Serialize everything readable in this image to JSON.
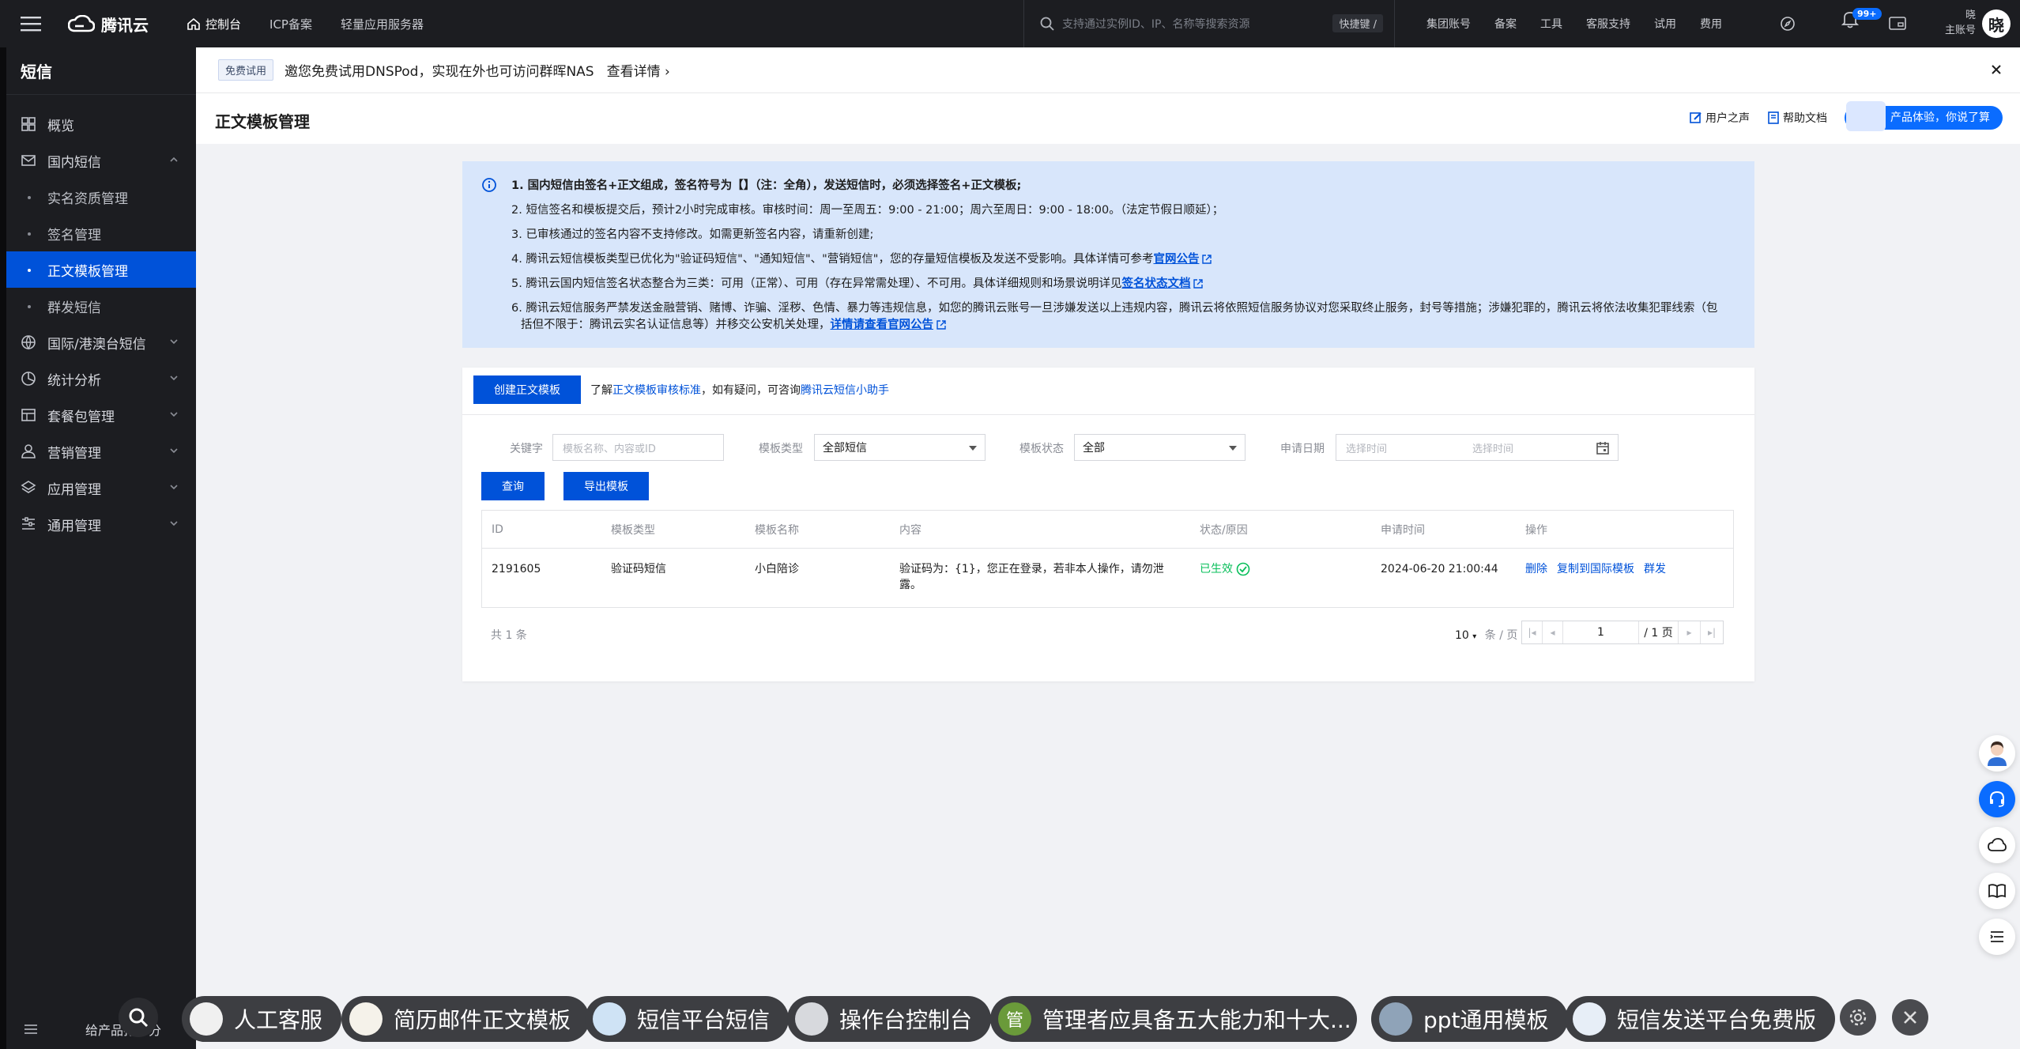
{
  "topbar": {
    "brand": "腾讯云",
    "nav": [
      "控制台",
      "ICP备案",
      "轻量应用服务器"
    ],
    "search_placeholder": "支持通过实例ID、IP、名称等搜索资源",
    "shortcut": "快捷键 /",
    "right_links": [
      "集团账号",
      "备案",
      "工具",
      "客服支持",
      "试用",
      "费用"
    ],
    "notif_count": "99+",
    "user_name": "晓",
    "user_role": "主账号",
    "avatar_char": "晓"
  },
  "sidebar": {
    "title": "短信",
    "items": [
      {
        "label": "概览",
        "icon": "dashboard-icon"
      },
      {
        "label": "国内短信",
        "icon": "mail-icon",
        "expanded": true
      },
      {
        "label": "实名资质管理",
        "sub": true
      },
      {
        "label": "签名管理",
        "sub": true
      },
      {
        "label": "正文模板管理",
        "sub": true,
        "active": true
      },
      {
        "label": "群发短信",
        "sub": true
      },
      {
        "label": "国际/港澳台短信",
        "icon": "globe-icon"
      },
      {
        "label": "统计分析",
        "icon": "pie-chart-icon"
      },
      {
        "label": "套餐包管理",
        "icon": "package-icon"
      },
      {
        "label": "营销管理",
        "icon": "user-group-icon"
      },
      {
        "label": "应用管理",
        "icon": "layers-icon"
      },
      {
        "label": "通用管理",
        "icon": "settings-list-icon"
      }
    ],
    "bottom_label": "给产品打个分"
  },
  "banner": {
    "badge": "免费试用",
    "text": "邀您免费试用DNSPod，实现在外也可访问群晖NAS",
    "link": "查看详情 ›"
  },
  "header": {
    "title": "正文模板管理",
    "links": [
      "用户之声",
      "帮助文档"
    ],
    "pill": "产品体验，你说了算"
  },
  "notice": {
    "lines": [
      {
        "text": "1. 国内短信由签名+正文组成，签名符号为【】（注：全角），发送短信时，必须选择签名+正文模板;",
        "bold": true
      },
      {
        "text": "2. 短信签名和模板提交后，预计2小时完成审核。审核时间：周一至周五：9:00 - 21:00；周六至周日：9:00 - 18:00。（法定节假日顺延）；"
      },
      {
        "text": "3. 已审核通过的签名内容不支持修改。如需更新签名内容，请重新创建;"
      },
      {
        "text": "4. 腾讯云短信模板类型已优化为\"验证码短信\"、\"通知短信\"、\"营销短信\"，您的存量短信模板及发送不受影响。具体详情可参考",
        "link": "官网公告"
      },
      {
        "text": "5. 腾讯云国内短信签名状态整合为三类：可用（正常）、可用（存在异常需处理）、不可用。具体详细规则和场景说明详见",
        "link": "签名状态文档"
      },
      {
        "text": "6. 腾讯云短信服务严禁发送金融营销、赌博、诈骗、淫秽、色情、暴力等违规信息，如您的腾讯云账号一旦涉嫌发送以上违规内容，腾讯云将依照短信服务协议对您采取终止服务，封号等措施；涉嫌犯罪的，腾讯云将依法收集犯罪线索（包"
      },
      {
        "text": "括但不限于：腾讯云实名认证信息等）并移交公安机关处理，",
        "link": "详情请查看官网公告",
        "indent": true
      }
    ]
  },
  "card": {
    "create_btn": "创建正文模板",
    "tip_prefix": "了解",
    "tip_link1": "正文模板审核标准",
    "tip_mid": "，如有疑问，可咨询",
    "tip_link2": "腾讯云短信小助手",
    "filters": {
      "keyword_label": "关键字",
      "keyword_placeholder": "模板名称、内容或ID",
      "type_label": "模板类型",
      "type_value": "全部短信",
      "status_label": "模板状态",
      "status_value": "全部",
      "date_label": "申请日期",
      "date_start": "选择时间",
      "date_end": "选择时间"
    },
    "query_btn": "查询",
    "export_btn": "导出模板",
    "columns": [
      "ID",
      "模板类型",
      "模板名称",
      "内容",
      "状态/原因",
      "申请时间",
      "操作"
    ],
    "rows": [
      {
        "id": "2191605",
        "type": "验证码短信",
        "name": "小白陪诊",
        "content_1": "验证码为：{1}，您正在登录，若非本人操作，请勿泄",
        "content_2": "露。",
        "status": "已生效",
        "time": "2024-06-20 21:00:44",
        "actions": [
          "删除",
          "复制到国际模板",
          "群发"
        ]
      }
    ],
    "pager": {
      "total": "共 1 条",
      "page_size": "10",
      "page_unit": "条 / 页",
      "current": "1",
      "total_pages": "/ 1 页"
    }
  },
  "taskbar": {
    "chips": [
      "人工客服",
      "简历邮件正文模板",
      "短信平台短信",
      "操作台控制台",
      "管理者应具备五大能力和十大...",
      "ppt通用模板",
      "短信发送平台免费版"
    ],
    "chip_avatar_text": "管"
  }
}
